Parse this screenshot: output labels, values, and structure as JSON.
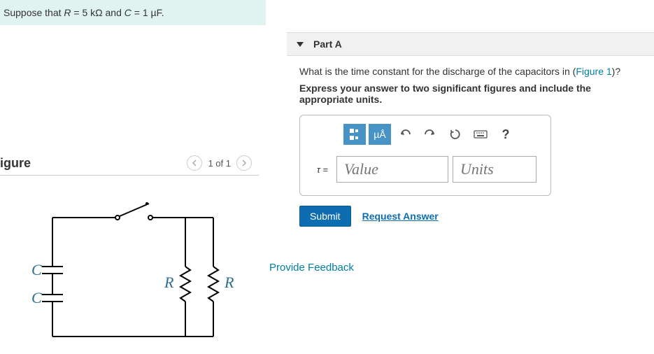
{
  "given": {
    "prefix": "Suppose that ",
    "r_sym": "R",
    "r_eq": " = 5 kΩ and ",
    "c_sym": "C",
    "c_eq": " = 1 µF."
  },
  "figure": {
    "title": "igure",
    "nav_text": "1 of 1",
    "labels": {
      "C1": "C",
      "C2": "C",
      "R1": "R",
      "R2": "R"
    }
  },
  "part": {
    "header": "Part A",
    "question_pre": "What is the time constant for the discharge of the capacitors in (",
    "question_link": "Figure 1",
    "question_post": ")?",
    "instruction": "Express your answer to two significant figures and include the appropriate units."
  },
  "answer": {
    "tau_label": "τ =",
    "value_placeholder": "Value",
    "units_placeholder": "Units",
    "tool_units": "µÅ",
    "tool_q": "?"
  },
  "actions": {
    "submit": "Submit",
    "request": "Request Answer"
  },
  "feedback": "Provide Feedback"
}
